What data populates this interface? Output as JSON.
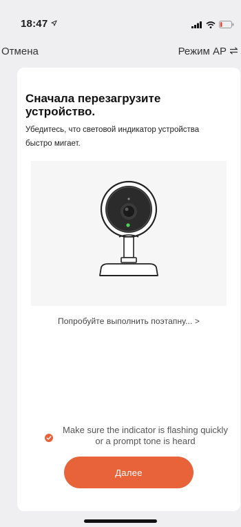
{
  "status_bar": {
    "time": "18:47",
    "location_icon": "location-arrow-icon",
    "signal_icon": "cellular-signal-icon",
    "wifi_icon": "wifi-icon",
    "battery_icon": "battery-low-icon"
  },
  "nav": {
    "cancel_label": "Отмена",
    "mode_label": "Режим AP",
    "mode_icon": "swap-arrows-icon"
  },
  "card": {
    "title": "Сначала перезагрузите устройство.",
    "description": "Убедитесь, что световой индикатор устройства быстро мигает.",
    "illustration": "security-camera-illustration",
    "step_link_label": "Попробуйте выполнить поэтапну... >",
    "confirm_text": "Make sure the indicator is flashing quickly or a prompt tone is heard",
    "confirm_checked": true,
    "next_button_label": "Далее"
  },
  "colors": {
    "accent": "#e8623a",
    "background": "#efeff1",
    "card": "#ffffff"
  }
}
